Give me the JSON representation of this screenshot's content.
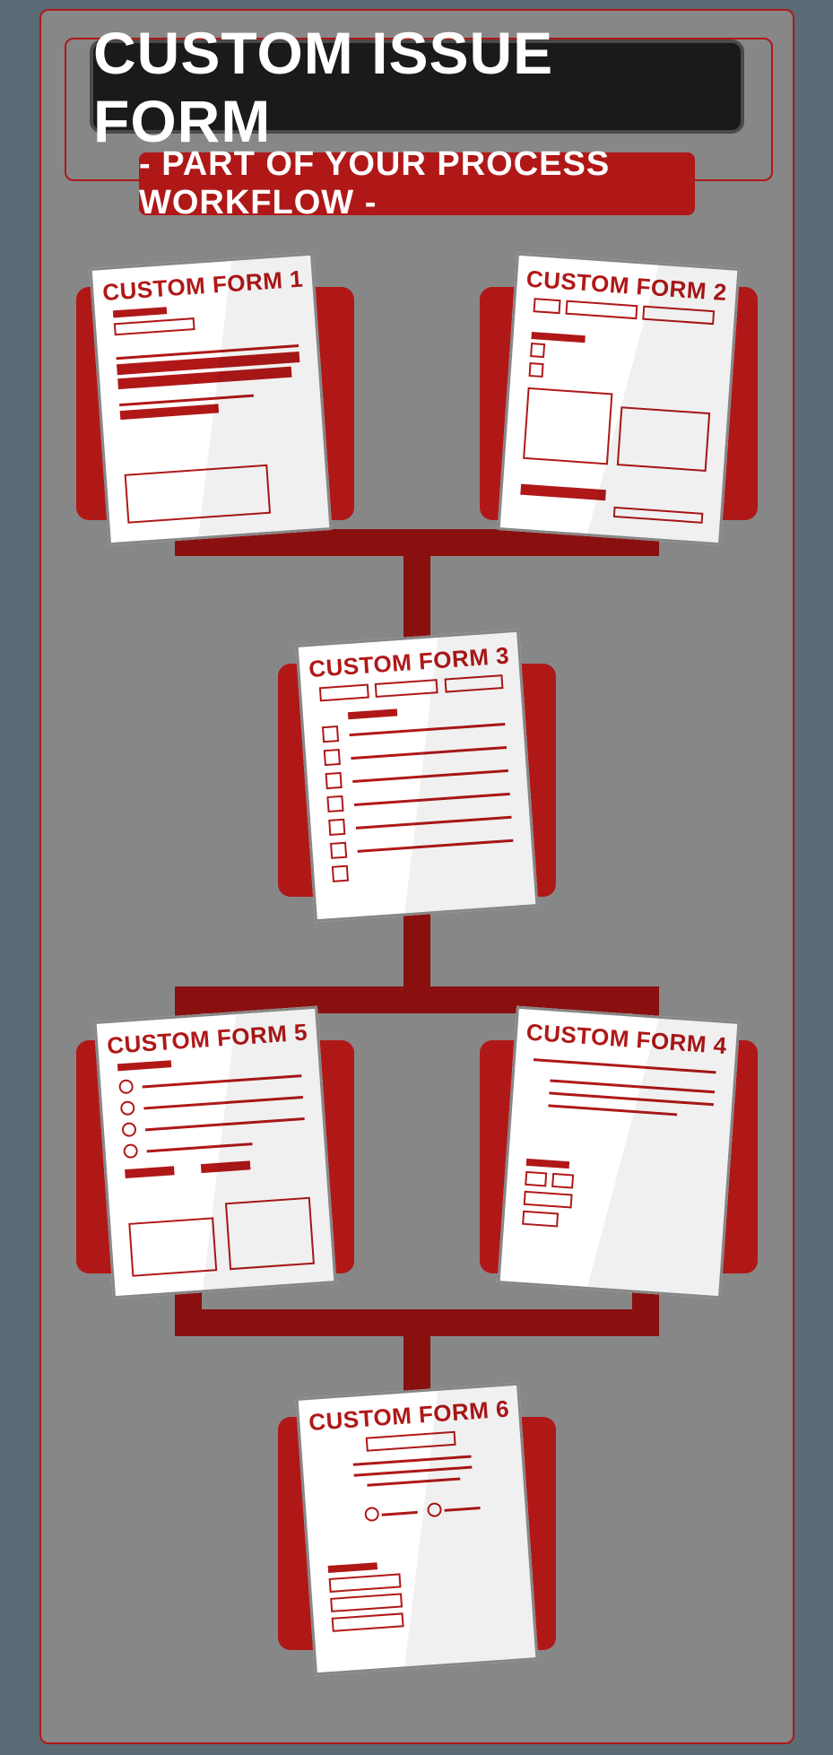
{
  "title": "CUSTOM ISSUE FORM",
  "subtitle": "- PART OF YOUR PROCESS WORKFLOW -",
  "forms": {
    "f1": {
      "label": "CUSTOM FORM 1"
    },
    "f2": {
      "label": "CUSTOM FORM 2"
    },
    "f3": {
      "label": "CUSTOM FORM 3"
    },
    "f4": {
      "label": "CUSTOM FORM 4"
    },
    "f5": {
      "label": "CUSTOM FORM 5"
    },
    "f6": {
      "label": "CUSTOM FORM 6"
    }
  },
  "workflow": {
    "edges": [
      [
        "f1",
        "f3"
      ],
      [
        "f2",
        "f3"
      ],
      [
        "f3",
        "f4"
      ],
      [
        "f3",
        "f5"
      ],
      [
        "f4",
        "f6"
      ],
      [
        "f5",
        "f6"
      ]
    ]
  }
}
